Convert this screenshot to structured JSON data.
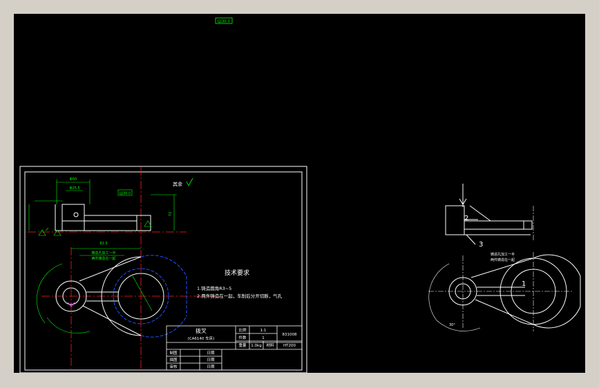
{
  "canvas": {
    "background": "#000000"
  },
  "colors": {
    "outline": "#ffffff",
    "dimension": "#00ff00",
    "center_line": "#ff2020",
    "hidden": "#2050ff",
    "magenta": "#ff40ff",
    "chrome": "#d4d0c8"
  },
  "top_tag": "Ш30.0",
  "left_sheet": {
    "roughness_label": "其余",
    "tech_title": "技术要求",
    "tech_items": [
      "1.铸造圆角R3~5",
      "2.两件铸造在一起，车削后分开切断，气孔"
    ],
    "section_tag": "Ш30.0",
    "dims": {
      "top_width": "Ф50",
      "top_bore": "Ф25.5",
      "center_distance": "82.5",
      "side_height": "72",
      "note_1": "铸造孔加工一半",
      "note_2": "两件铸造在一起"
    },
    "title_block": {
      "part_name": "拨叉",
      "subtitle": "(CA6140 车床)",
      "scale_label": "比例",
      "scale_value": "1:1",
      "drawing_no": "831008",
      "qty_label": "件数",
      "qty_value": "1",
      "weight_label": "重量",
      "weight_value": "1.0kg",
      "material_label": "材料",
      "material_value": "HT200",
      "rows": [
        [
          "制图",
          "日期"
        ],
        [
          "描图",
          "日期"
        ],
        [
          "审核",
          "日期"
        ]
      ]
    }
  },
  "right_sheet": {
    "labels": [
      "2",
      "3",
      "1"
    ],
    "note_1": "铸造孔加工一半",
    "note_2": "两件铸造在一起",
    "angle": "30°"
  }
}
